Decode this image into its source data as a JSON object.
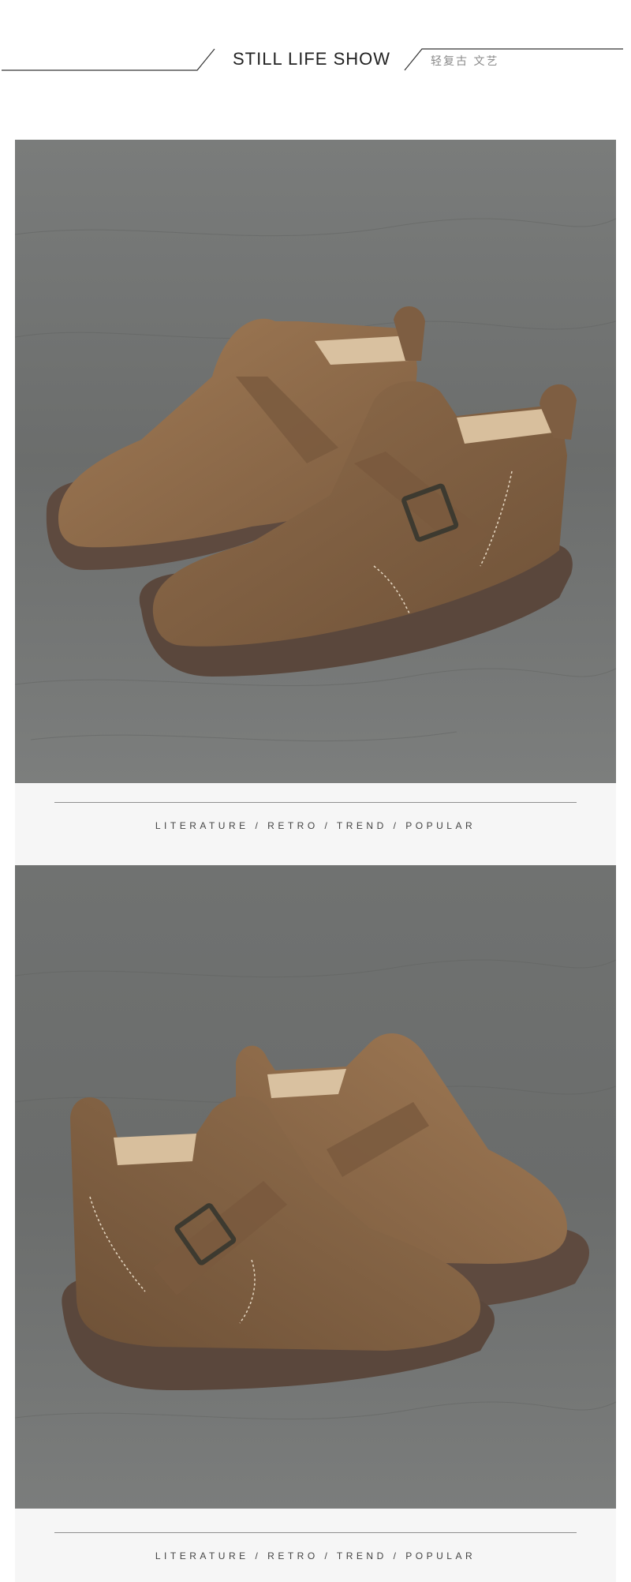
{
  "header": {
    "title": "STILL LIFE SHOW",
    "subtitle": "轻复古 文艺"
  },
  "photos": [
    {
      "name": "product-photo-1",
      "subject": "two brown leather ankle boots with buckle strap on grey textured background"
    },
    {
      "name": "product-photo-2",
      "subject": "two brown leather ankle boots with buckle strap, reverse angle, on grey textured background"
    }
  ],
  "bands": [
    {
      "tagline": "LITERATURE  /  RETRO  /  TREND  /  POPULAR"
    },
    {
      "tagline": "LITERATURE  /  RETRO  /  TREND  /  POPULAR"
    }
  ],
  "colors": {
    "leather": "#8c6a4a",
    "sole": "#5e4a3f",
    "background_grey": "#6f7170",
    "band": "#f6f6f6"
  }
}
